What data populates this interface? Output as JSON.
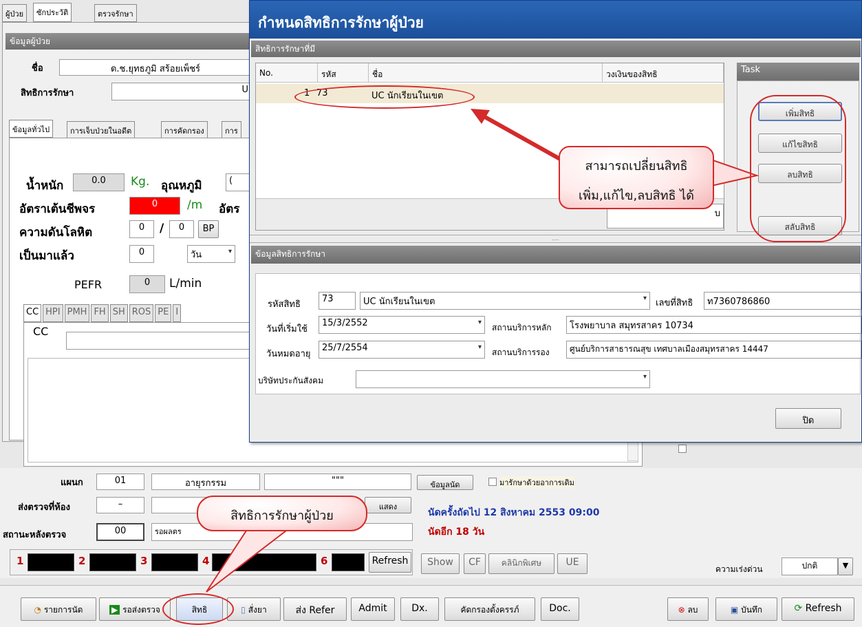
{
  "tabs_top": [
    "ผู้ป่วย",
    "ซักประวัติ",
    "ตรวจรักษา"
  ],
  "patient_header": "ข้อมูลผู้ป่วย",
  "name_label": "ชื่อ",
  "name_value": "ด.ช.ยุทธภูมิ สร้อยเพ็ชร์",
  "right_label": "สิทธิการรักษา",
  "right_value_partial": "U",
  "subtabs": [
    "ข้อมูลทั่วไป",
    "การเจ็บป่วยในอดีต",
    "การคัดกรอง",
    "การ"
  ],
  "weight_label": "น้ำหนัก",
  "weight_value": "0.0",
  "weight_unit": "Kg.",
  "temp_label": "อุณหภูมิ",
  "temp_value_partial": "(",
  "pulse_label": "อัตราเต้นชีพจร",
  "pulse_value": "0",
  "pulse_unit": "/m",
  "rr_label_partial": "อัตร",
  "bp_label": "ความดันโลหิต",
  "bp_sys": "0",
  "bp_sep": "/",
  "bp_dia": "0",
  "bp_button": "BP",
  "since_label": "เป็นมาแล้ว",
  "since_value": "0",
  "since_unit": "วัน",
  "pefr_label": "PEFR",
  "pefr_value": "0",
  "pefr_unit": "L/min",
  "cc_tabs": [
    "CC",
    "HPI",
    "PMH",
    "FH",
    "SH",
    "ROS",
    "PE",
    "I"
  ],
  "cc_label": "CC",
  "dept_label": "แผนก",
  "dept_code": "01",
  "dept_name": "อายุรกรรม",
  "dept_extra": "\"\"\"",
  "appt_info_button": "ข้อมูลนัด",
  "old_symptom_label": "มารักษาด้วยอาการเดิม",
  "room_label": "ส่งตรวจที่ห้อง",
  "room_value": "–",
  "show_button": "แสดง",
  "next_appt": "นัดครั้งถัดไป 12 สิงหาคม 2553 09:00",
  "appt_in": "นัดอีก 18 วัน",
  "status_label": "สถานะหลังตรวจ",
  "status_code": "00",
  "status_name_partial": "รอผลตร",
  "queue_nums": [
    "1",
    "2",
    "3",
    "4",
    "6"
  ],
  "refresh_button": "Refresh",
  "mid_buttons": [
    "Show",
    "CF",
    "คลินิกพิเศษ",
    "UE"
  ],
  "urgency_label": "ความเร่งด่วน",
  "urgency_value": "ปกติ",
  "bottom_buttons": {
    "appt": "รายการนัด",
    "send": "รอส่งตรวจ",
    "rights": "สิทธิ",
    "rx": "สั่งยา",
    "refer": "ส่ง Refer",
    "admit": "Admit",
    "dx": "Dx.",
    "prenatal": "คัดกรองตั้งครรภ์",
    "doc": "Doc.",
    "delete": "ลบ",
    "save": "บันทึก",
    "refresh": "Refresh"
  },
  "dialog": {
    "title": "กำหนดสิทธิการรักษาผู้ป่วย",
    "section1": "สิทธิการรักษาที่มี",
    "columns": [
      "No.",
      "รหัส",
      "ชื่อ",
      "วงเงินของสิทธิ"
    ],
    "rows": [
      {
        "no": "1",
        "code": "73",
        "name": "UC นักเรียนในเขต",
        "limit": ""
      }
    ],
    "task_title": "Task",
    "task_buttons": [
      "เพิ่มสิทธิ",
      "แก้ไขสิทธิ",
      "ลบสิทธิ",
      "สลับสิทธิ"
    ],
    "partial_field": "บ",
    "section2": "ข้อมูลสิทธิการรักษา",
    "code_label": "รหัสสิทธิ",
    "code_value": "73",
    "code_name": "UC นักเรียนในเขต",
    "no_label": "เลขที่สิทธิ",
    "no_value": "ท7360786860",
    "start_label": "วันที่เริ่มใช้",
    "start_value": "15/3/2552",
    "main_hosp_label": "สถานบริการหลัก",
    "main_hosp_value": "โรงพยาบาล สมุทรสาคร 10734",
    "expire_label": "วันหมดอายุ",
    "expire_value": "25/7/2554",
    "sub_hosp_label": "สถานบริการรอง",
    "sub_hosp_value": "ศูนย์บริการสาธารณสุข เทศบาลเมืองสมุทรสาคร 14447",
    "insurer_label": "บริษัทประกันสังคม",
    "close_button": "ปิด"
  },
  "callouts": {
    "change": "สามารถเปลี่ยนสิทธิ",
    "change2": "เพิ่ม,แก้ไข,ลบสิทธิ ได้",
    "rights": "สิทธิการรักษาผู้ป่วย"
  },
  "colors": {
    "accent_red": "#d42a2a",
    "title_blue": "#1c4f9a",
    "header_gray": "#7b7b7b"
  }
}
